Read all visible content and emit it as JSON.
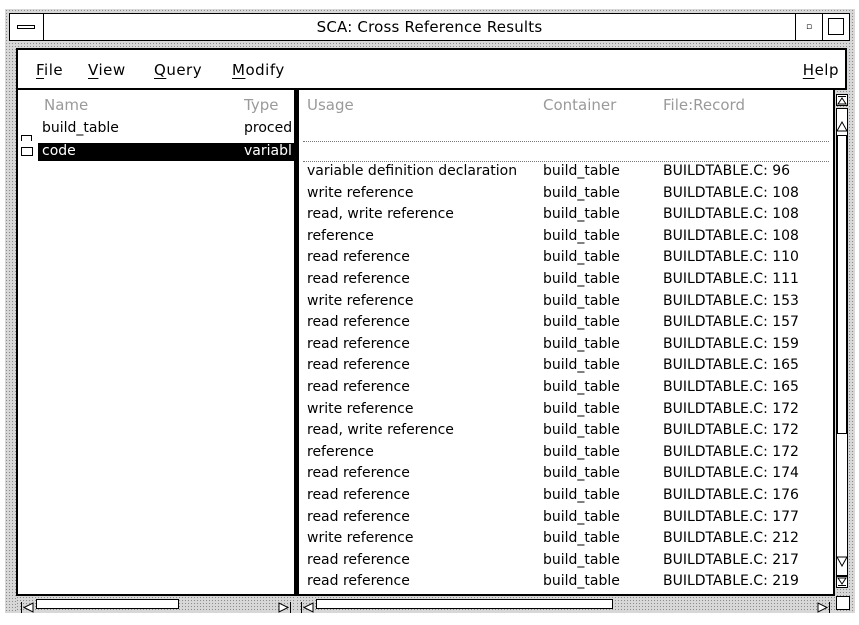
{
  "window": {
    "title": "SCA: Cross Reference Results",
    "min_glyph": "▫"
  },
  "menubar": {
    "file": {
      "mnemonic": "F",
      "rest": "ile"
    },
    "view": {
      "mnemonic": "V",
      "rest": "iew"
    },
    "query": {
      "mnemonic": "Q",
      "rest": "uery"
    },
    "modify": {
      "mnemonic": "M",
      "rest": "odify"
    },
    "help": {
      "mnemonic": "H",
      "rest": "elp"
    }
  },
  "left_pane": {
    "headers": {
      "name": "Name",
      "type": "Type"
    },
    "rows": [
      {
        "name": "build_table",
        "type": "proced",
        "selected": false
      },
      {
        "name": "code",
        "type": "variabl",
        "selected": true
      }
    ]
  },
  "right_pane": {
    "headers": {
      "usage": "Usage",
      "container": "Container",
      "file_record": "File:Record"
    },
    "rows": [
      {
        "usage": "variable definition declaration",
        "container": "build_table",
        "file_record": "BUILDTABLE.C: 96"
      },
      {
        "usage": "write reference",
        "container": "build_table",
        "file_record": "BUILDTABLE.C: 108"
      },
      {
        "usage": "read, write reference",
        "container": "build_table",
        "file_record": "BUILDTABLE.C: 108"
      },
      {
        "usage": "reference",
        "container": "build_table",
        "file_record": "BUILDTABLE.C: 108"
      },
      {
        "usage": "read reference",
        "container": "build_table",
        "file_record": "BUILDTABLE.C: 110"
      },
      {
        "usage": "read reference",
        "container": "build_table",
        "file_record": "BUILDTABLE.C: 111"
      },
      {
        "usage": "write reference",
        "container": "build_table",
        "file_record": "BUILDTABLE.C: 153"
      },
      {
        "usage": "read reference",
        "container": "build_table",
        "file_record": "BUILDTABLE.C: 157"
      },
      {
        "usage": "read reference",
        "container": "build_table",
        "file_record": "BUILDTABLE.C: 159"
      },
      {
        "usage": "read reference",
        "container": "build_table",
        "file_record": "BUILDTABLE.C: 165"
      },
      {
        "usage": "read reference",
        "container": "build_table",
        "file_record": "BUILDTABLE.C: 165"
      },
      {
        "usage": "write reference",
        "container": "build_table",
        "file_record": "BUILDTABLE.C: 172"
      },
      {
        "usage": "read, write reference",
        "container": "build_table",
        "file_record": "BUILDTABLE.C: 172"
      },
      {
        "usage": "reference",
        "container": "build_table",
        "file_record": "BUILDTABLE.C: 172"
      },
      {
        "usage": "read reference",
        "container": "build_table",
        "file_record": "BUILDTABLE.C: 174"
      },
      {
        "usage": "read reference",
        "container": "build_table",
        "file_record": "BUILDTABLE.C: 176"
      },
      {
        "usage": "read reference",
        "container": "build_table",
        "file_record": "BUILDTABLE.C: 177"
      },
      {
        "usage": "write reference",
        "container": "build_table",
        "file_record": "BUILDTABLE.C: 212"
      },
      {
        "usage": "read reference",
        "container": "build_table",
        "file_record": "BUILDTABLE.C: 217"
      },
      {
        "usage": "read reference",
        "container": "build_table",
        "file_record": "BUILDTABLE.C: 219"
      }
    ]
  },
  "icons": {
    "system_menu": "system-menu-icon",
    "minimize": "minimize-icon",
    "maximize": "maximize-icon",
    "row_marker": "folder-tab-icon",
    "scroll_up": "scroll-up-arrow-icon",
    "scroll_down": "scroll-down-arrow-icon",
    "scroll_left": "scroll-left-arrow-icon",
    "scroll_right": "scroll-right-arrow-icon"
  },
  "colors": {
    "selection_bg": "#000000",
    "selection_fg": "#ffffff",
    "header_text": "#9a9a9a",
    "stipple": "#d8d8d8"
  }
}
